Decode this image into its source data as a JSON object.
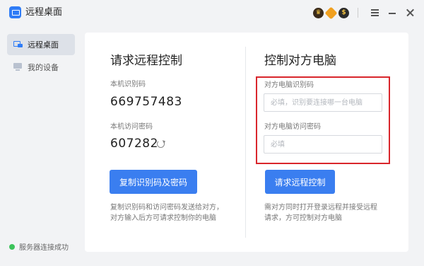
{
  "window": {
    "title": "远程桌面",
    "badges": {
      "crown": "♛",
      "hex": "●",
      "coin": "$"
    }
  },
  "sidebar": {
    "items": [
      {
        "label": "远程桌面",
        "icon": "remote-desktop-icon",
        "active": true
      },
      {
        "label": "我的设备",
        "icon": "device-monitor-icon",
        "active": false
      }
    ],
    "status": {
      "text": "服务器连接成功",
      "color": "#3cc35a"
    }
  },
  "request": {
    "title": "请求远程控制",
    "id_label": "本机识别码",
    "id_value": "669757483",
    "password_label": "本机访问密码",
    "password_value": "607282",
    "copy_button": "复制识别码及密码",
    "hint_line1": "复制识别码和访问密码发送给对方，",
    "hint_line2": "对方输入后方可请求控制你的电脑"
  },
  "control": {
    "title": "控制对方电脑",
    "id_label": "对方电脑识别码",
    "id_placeholder": "必填，识别要连接哪一台电脑",
    "password_label": "对方电脑访问密码",
    "password_placeholder": "必填",
    "request_button": "请求远程控制",
    "hint_line1": "需对方同时打开登录远程并接受远程",
    "hint_line2": "请求，方可控制对方电脑"
  },
  "colors": {
    "accent": "#3a7ef0",
    "highlight_box": "#d9262c",
    "status_ok": "#3cc35a"
  }
}
